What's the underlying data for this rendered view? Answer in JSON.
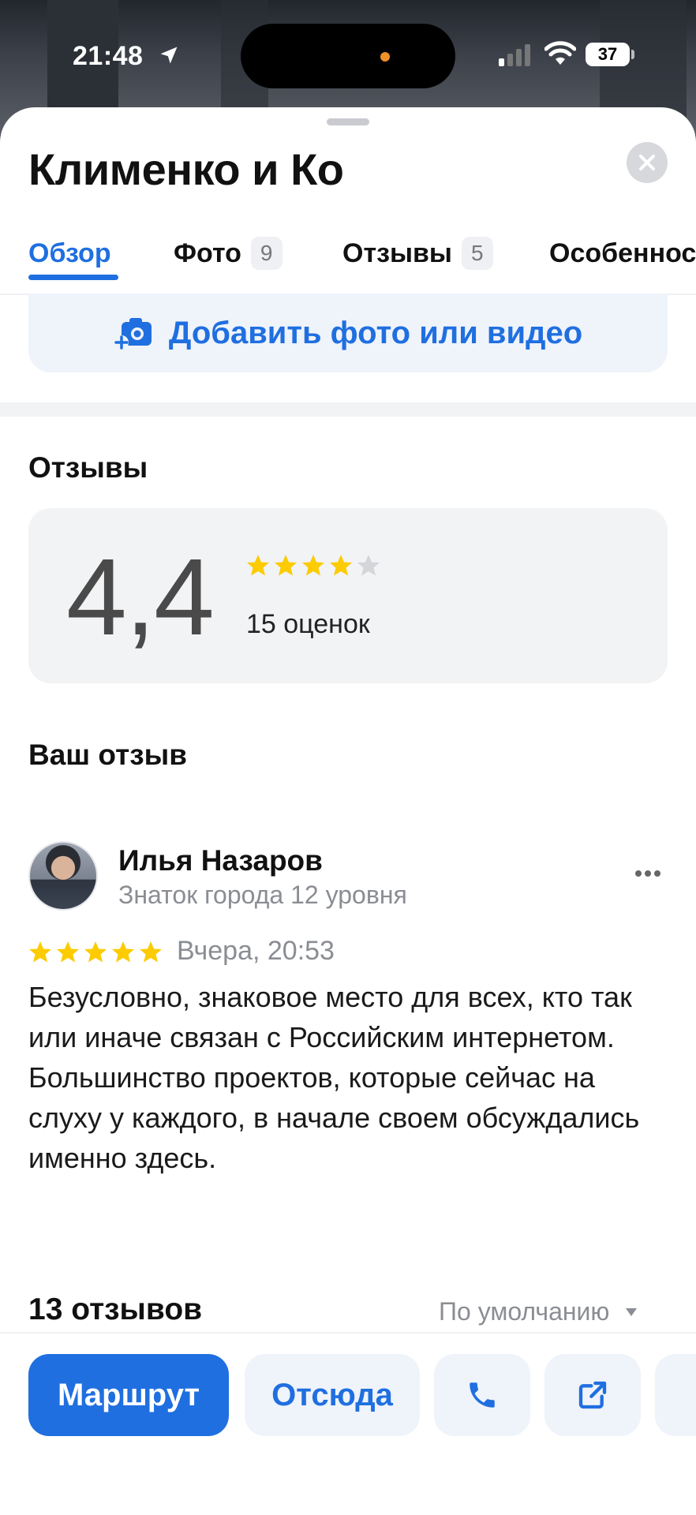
{
  "status_bar": {
    "time": "21:48",
    "battery": "37"
  },
  "place": {
    "title": "Клименко и Ко"
  },
  "tabs": [
    {
      "label": "Обзор",
      "count": ""
    },
    {
      "label": "Фото",
      "count": "9"
    },
    {
      "label": "Отзывы",
      "count": "5"
    },
    {
      "label": "Особенности"
    }
  ],
  "add_media": {
    "label": "Добавить фото или видео"
  },
  "reviews_section": {
    "title": "Отзывы",
    "rating": "4,4",
    "rating_value": 4,
    "rating_max": 5,
    "ratings_count": "15 оценок"
  },
  "your_review": {
    "title": "Ваш отзыв",
    "author": "Илья Назаров",
    "author_level": "Знаток города 12 уровня",
    "stars": 5,
    "date": "Вчера, 20:53",
    "text": "Безусловно, знаковое место для всех, кто так или иначе связан с Российским интернетом. Большинство проектов, которые сейчас на слуху у каждого, в начале своем обсуждались именно здесь."
  },
  "reviews_list": {
    "count": "13 отзывов",
    "sort": "По умолчанию"
  },
  "actions": {
    "route": "Маршрут",
    "from_here": "Отсюда"
  },
  "colors": {
    "accent": "#1f6fe0",
    "star": "#fccb00",
    "star_empty": "#d4d5d8"
  }
}
